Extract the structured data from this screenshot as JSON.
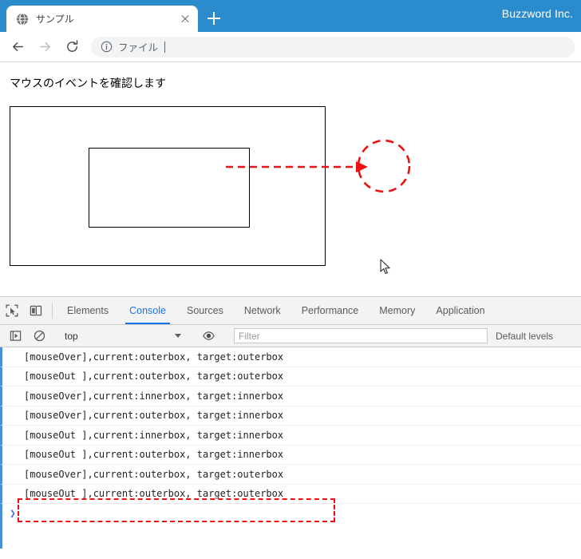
{
  "browser": {
    "brand": "Buzzword Inc.",
    "tab": {
      "title": "サンプル",
      "favicon_icon": "globe-icon",
      "close_icon": "close-icon"
    },
    "new_tab_icon": "plus-icon",
    "nav": {
      "back_icon": "arrow-left-icon",
      "forward_icon": "arrow-right-icon",
      "reload_icon": "reload-icon"
    },
    "omnibox": {
      "info_icon": "info-circle-icon",
      "value": "ファイル",
      "separator": "|"
    }
  },
  "page": {
    "heading": "マウスのイベントを確認します",
    "outerbox_name": "outerbox",
    "innerbox_name": "innerbox",
    "cursor_icon": "mouse-pointer-icon",
    "annotation_color": "#ee1111"
  },
  "devtools": {
    "inspect_icon": "inspect-element-icon",
    "device_icon": "device-toolbar-icon",
    "tabs": [
      {
        "label": "Elements",
        "active": false
      },
      {
        "label": "Console",
        "active": true
      },
      {
        "label": "Sources",
        "active": false
      },
      {
        "label": "Network",
        "active": false
      },
      {
        "label": "Performance",
        "active": false
      },
      {
        "label": "Memory",
        "active": false
      },
      {
        "label": "Application",
        "active": false
      }
    ],
    "filterbar": {
      "execute_icon": "execute-snippet-icon",
      "clear_icon": "clear-console-icon",
      "context": "top",
      "eye_icon": "live-expression-icon",
      "filter_placeholder": "Filter",
      "levels_label": "Default levels"
    },
    "console_rows": [
      "[mouseOver],current:outerbox, target:outerbox",
      "[mouseOut ],current:outerbox, target:outerbox",
      "[mouseOver],current:innerbox, target:innerbox",
      "[mouseOver],current:outerbox, target:innerbox",
      "[mouseOut ],current:innerbox, target:innerbox",
      "[mouseOut ],current:outerbox, target:innerbox",
      "[mouseOver],current:outerbox, target:outerbox",
      "[mouseOut ],current:outerbox, target:outerbox"
    ],
    "highlighted_row_index": 7,
    "prompt_symbol": "❯"
  }
}
